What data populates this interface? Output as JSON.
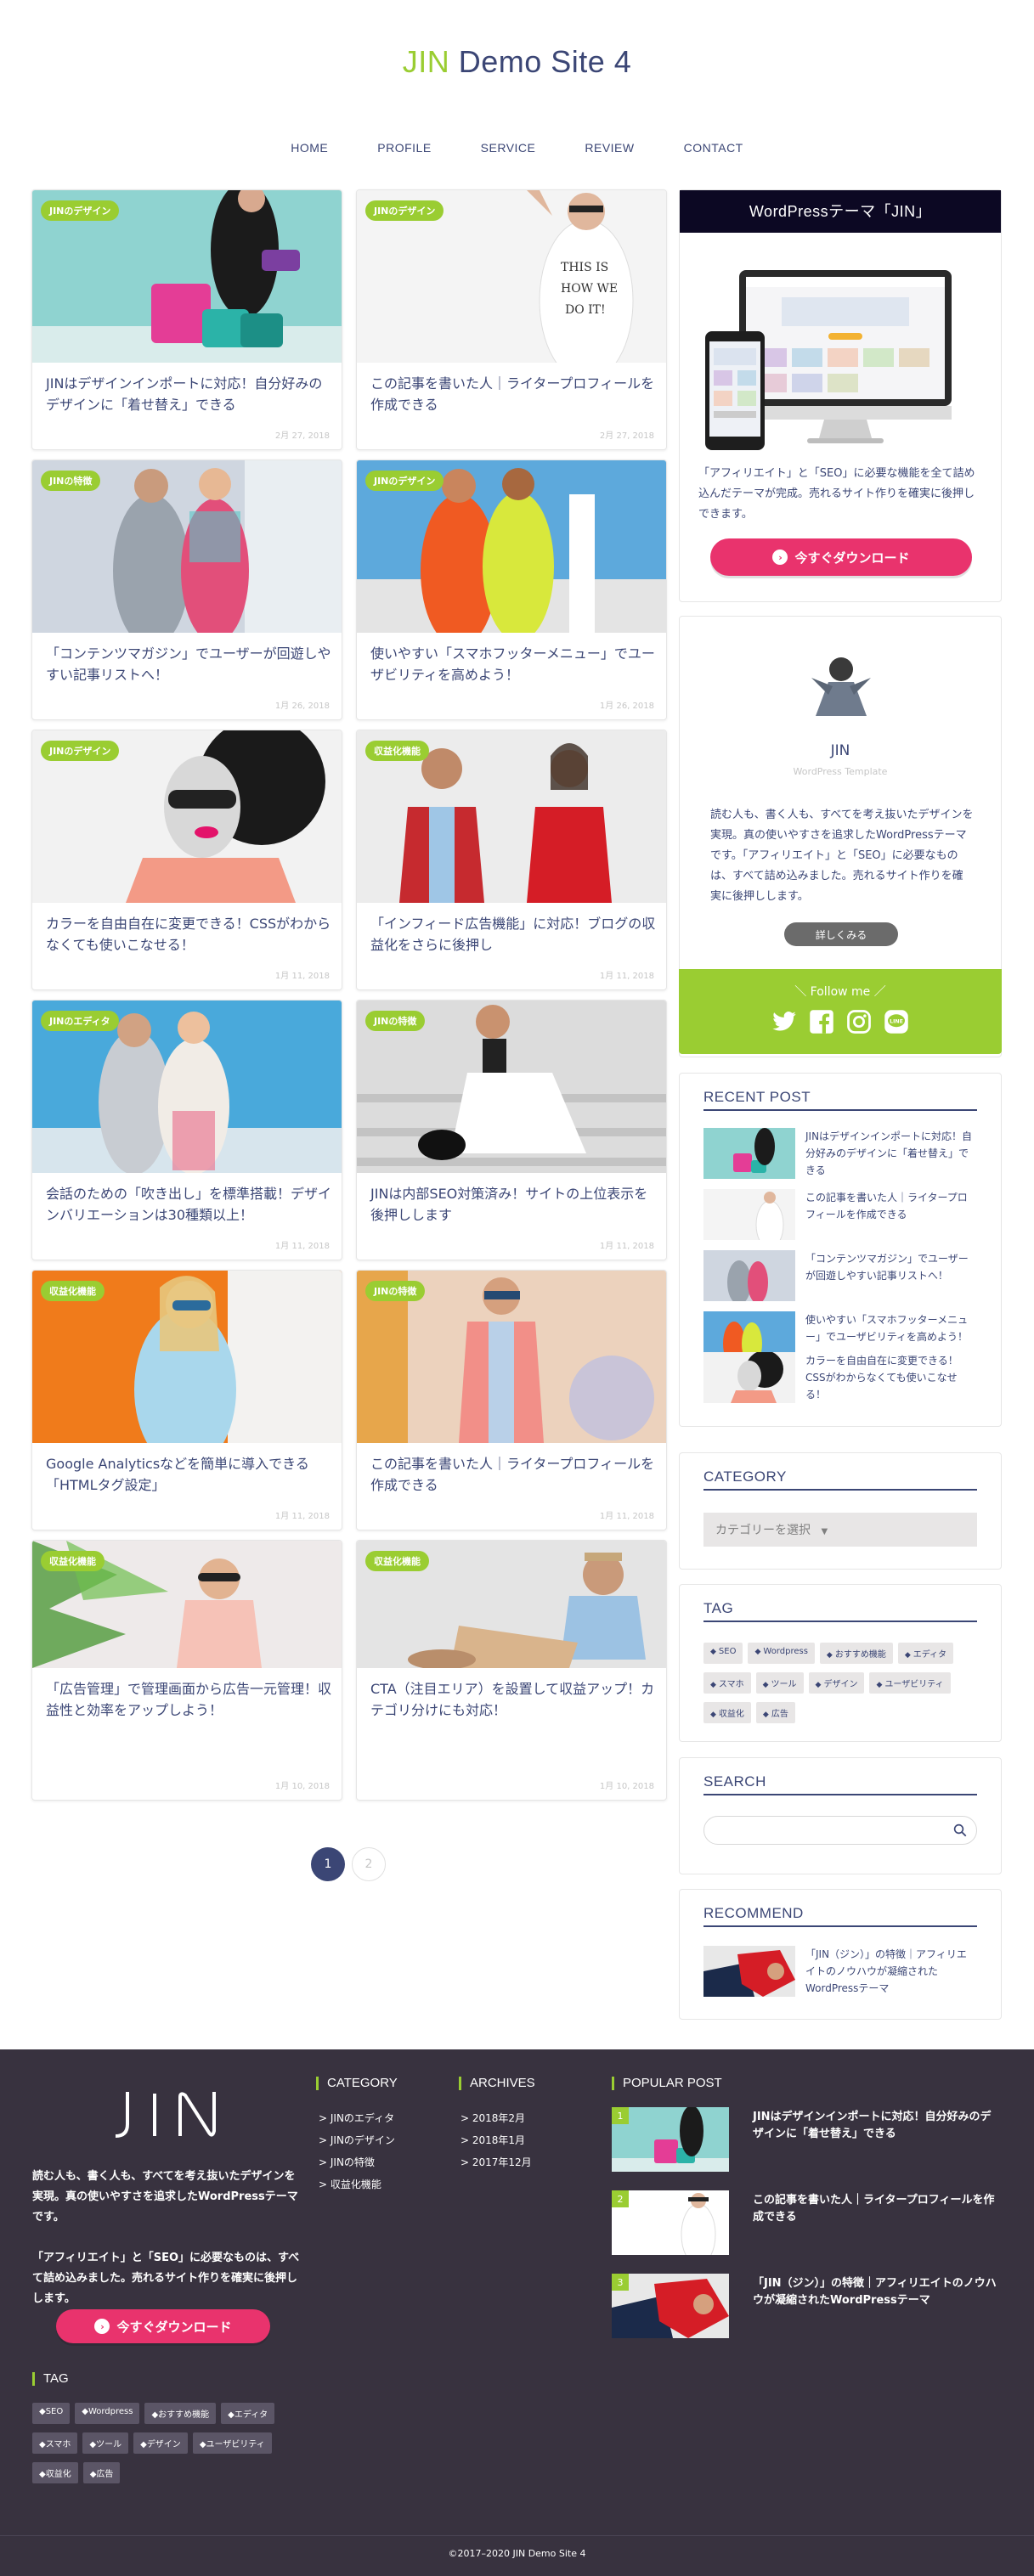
{
  "site": {
    "title_accent": "JIN",
    "title_rest": " Demo Site 4"
  },
  "nav": [
    "HOME",
    "PROFILE",
    "SERVICE",
    "REVIEW",
    "CONTACT"
  ],
  "posts": [
    {
      "category": "JINのデザイン",
      "title": "JINはデザインインポートに対応！自分好みのデザインに「着せ替え」できる",
      "date": "2月 27, 2018"
    },
    {
      "category": "JINのデザイン",
      "title": "この記事を書いた人｜ライタープロフィールを作成できる",
      "date": "2月 27, 2018"
    },
    {
      "category": "JINの特徴",
      "title": "「コンテンツマガジン」でユーザーが回遊しやすい記事リストへ！",
      "date": "1月 26, 2018"
    },
    {
      "category": "JINのデザイン",
      "title": "使いやすい「スマホフッターメニュー」でユーザビリティを高めよう！",
      "date": "1月 26, 2018"
    },
    {
      "category": "JINのデザイン",
      "title": "カラーを自由自在に変更できる！CSSがわからなくても使いこなせる！",
      "date": "1月 11, 2018"
    },
    {
      "category": "収益化機能",
      "title": "「インフィード広告機能」に対応！ブログの収益化をさらに後押し",
      "date": "1月 11, 2018"
    },
    {
      "category": "JINのエディタ",
      "title": "会話のための「吹き出し」を標準搭載！デザインバリエーションは30種類以上！",
      "date": "1月 11, 2018"
    },
    {
      "category": "JINの特徴",
      "title": "JINは内部SEO対策済み！サイトの上位表示を後押しします",
      "date": "1月 11, 2018"
    },
    {
      "category": "収益化機能",
      "title": "Google Analyticsなどを簡単に導入できる「HTMLタグ設定」",
      "date": "1月 11, 2018"
    },
    {
      "category": "JINの特徴",
      "title": "この記事を書いた人｜ライタープロフィールを作成できる",
      "date": "1月 11, 2018"
    },
    {
      "category": "収益化機能",
      "title": "「広告管理」で管理画面から広告一元管理！収益性と効率をアップしよう！",
      "date": "1月 10, 2018"
    },
    {
      "category": "収益化機能",
      "title": "CTA（注目エリア）を設置して収益アップ！カテゴリ分けにも対応！",
      "date": "1月 10, 2018"
    }
  ],
  "pagination": {
    "current": "1",
    "next": "2"
  },
  "ad": {
    "title": "WordPressテーマ「JIN」",
    "description": "「アフィリエイト」と「SEO」に必要な機能を全て詰め込んだテーマが完成。売れるサイト作りを確実に後押しできます。",
    "button": "今すぐダウンロード"
  },
  "profile": {
    "name": "JIN",
    "subtitle": "WordPress Template",
    "description": "読む人も、書く人も、すべてを考え抜いたデザインを実現。真の使いやすさを追求したWordPressテーマです。「アフィリエイト」と「SEO」に必要なものは、すべて詰め込みました。売れるサイト作りを確実に後押しします。",
    "button": "詳しくみる"
  },
  "follow": {
    "title": "＼ Follow me ／"
  },
  "recent": {
    "title": "RECENT POST",
    "items": [
      "JINはデザインインポートに対応！自分好みのデザインに「着せ替え」できる",
      "この記事を書いた人｜ライタープロフィールを作成できる",
      "「コンテンツマガジン」でユーザーが回遊しやすい記事リストへ！",
      "使いやすい「スマホフッターメニュー」でユーザビリティを高めよう！",
      "カラーを自由自在に変更できる！CSSがわからなくても使いこなせる！"
    ]
  },
  "category_widget": {
    "title": "CATEGORY",
    "select": "カテゴリーを選択"
  },
  "tag_widget": {
    "title": "TAG",
    "tags": [
      "SEO",
      "Wordpress",
      "おすすめ機能",
      "エディタ",
      "スマホ",
      "ツール",
      "デザイン",
      "ユーザビリティ",
      "収益化",
      "広告"
    ]
  },
  "search_widget": {
    "title": "SEARCH"
  },
  "recommend": {
    "title": "RECOMMEND",
    "item": "「JIN（ジン）」の特徴｜アフィリエイトのノウハウが凝縮されたWordPressテーマ"
  },
  "footer": {
    "logo_text": "JIN",
    "desc1": "読む人も、書く人も、すべてを考え抜いたデザインを実現。真の使いやすさを追求したWordPressテーマです。",
    "desc2": "「アフィリエイト」と「SEO」に必要なものは、すべて詰め込みました。売れるサイト作りを確実に後押しします。",
    "button": "今すぐダウンロード",
    "tag_title": "TAG",
    "tags": [
      "SEO",
      "Wordpress",
      "おすすめ機能",
      "エディタ",
      "スマホ",
      "ツール",
      "デザイン",
      "ユーザビリティ",
      "収益化",
      "広告"
    ],
    "category_title": "CATEGORY",
    "categories": [
      "> JINのエディタ",
      "> JINのデザイン",
      "> JINの特徴",
      "> 収益化機能"
    ],
    "archives_title": "ARCHIVES",
    "archives": [
      "> 2018年2月",
      "> 2018年1月",
      "> 2017年12月"
    ],
    "popular_title": "POPULAR POST",
    "popular": [
      {
        "rank": "1",
        "title": "JINはデザインインポートに対応！自分好みのデザインに「着せ替え」できる"
      },
      {
        "rank": "2",
        "title": "この記事を書いた人｜ライタープロフィールを作成できる"
      },
      {
        "rank": "3",
        "title": "「JIN（ジン）」の特徴｜アフィリエイトのノウハウが凝縮されたWordPressテーマ"
      }
    ],
    "copyright": "©2017–2020 JIN Demo Site 4"
  },
  "colors": {
    "accent": "#9acd32",
    "text": "#3b4675",
    "button": "#e9336d",
    "footer_bg": "#38323f",
    "ad_header": "#0c0823"
  }
}
